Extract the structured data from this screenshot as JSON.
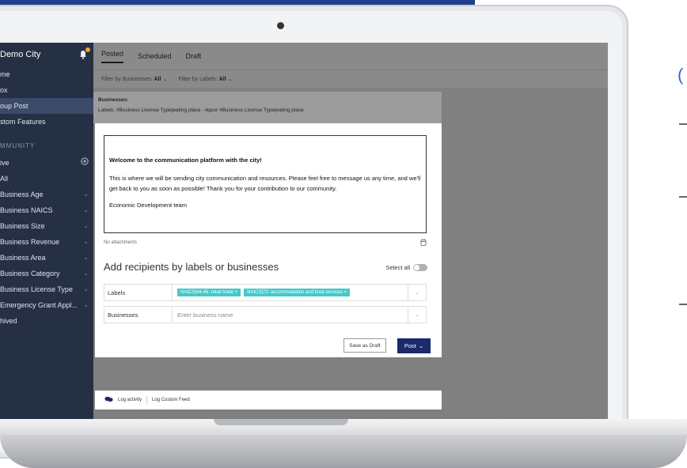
{
  "sidebar": {
    "org_name": "Demo City",
    "items": [
      {
        "label": "me"
      },
      {
        "label": "ox"
      },
      {
        "label": "oup Post",
        "active": true
      },
      {
        "label": "stom Features"
      }
    ],
    "section_label": "MMUNITY",
    "ive_label": "ive",
    "groups": [
      {
        "label": "All"
      },
      {
        "label": "Business Age"
      },
      {
        "label": "Business NAICS"
      },
      {
        "label": "Business Size"
      },
      {
        "label": "Business Revenue"
      },
      {
        "label": "Business Area"
      },
      {
        "label": "Business Category"
      },
      {
        "label": "Business License Type"
      },
      {
        "label": "Emergency Grant Appl..."
      }
    ],
    "archived_label": "hived"
  },
  "tabs": [
    "Posted",
    "Scheduled",
    "Draft"
  ],
  "filters": {
    "business_label": "Filter by Businesses:",
    "business_value": "All",
    "labels_label": "Filter by Labels:",
    "labels_value": "All"
  },
  "overlay": {
    "businesses_label": "Businesses:",
    "labels_line": "Labels:  #Business License Type|eating place - liquor   #Business License Type|eating place"
  },
  "editor": {
    "title": "Welcome to the communication platform with the city!",
    "body": "This is where we will be sending city communication and resources. Please feel free to message us any time, and we'll get back to you as soon as possible! Thank you for your contribution to our community.",
    "signature": "Economic Development team"
  },
  "attachments": "No attachments",
  "recipients": {
    "title": "Add recipients by labels or businesses",
    "select_all": "Select all",
    "labels_field": "Labels",
    "chips": [
      "NAICS|44-45: retail trade",
      "NAICS|72: accommodation and food services"
    ],
    "businesses_field": "Businesses",
    "businesses_placeholder": "Enter business name"
  },
  "buttons": {
    "save_draft": "Save as Draft",
    "post": "Post"
  },
  "log": {
    "activity": "Log activity",
    "custom_feed": "Log Custom Feed"
  },
  "colors": {
    "sidebar_bg": "#253045",
    "chip": "#45c9c9",
    "primary": "#1b2a6b",
    "accent_blue": "#2f66d9"
  }
}
